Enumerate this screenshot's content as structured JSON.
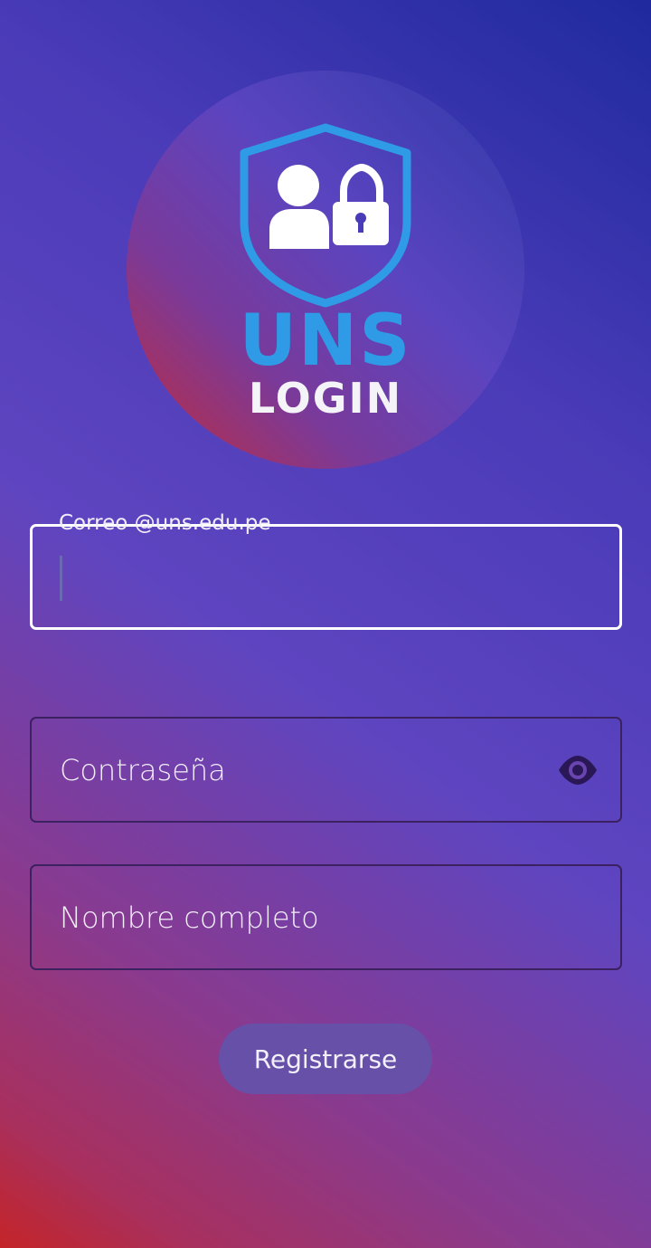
{
  "logo": {
    "title": "UNS",
    "subtitle": "LOGIN",
    "icon": "shield-user-lock-icon",
    "colors": {
      "accent": "#2f9ae6",
      "text": "#f4f4f8"
    }
  },
  "form": {
    "email": {
      "label": "Correo @uns.edu.pe",
      "value": ""
    },
    "password": {
      "placeholder": "Contraseña",
      "toggle_icon": "eye-icon"
    },
    "full_name": {
      "placeholder": "Nombre completo"
    },
    "submit_label": "Registrarse"
  },
  "colors": {
    "button_bg": "#6650a8",
    "field_border_active": "#ffffff",
    "field_border": "#3b2160"
  }
}
